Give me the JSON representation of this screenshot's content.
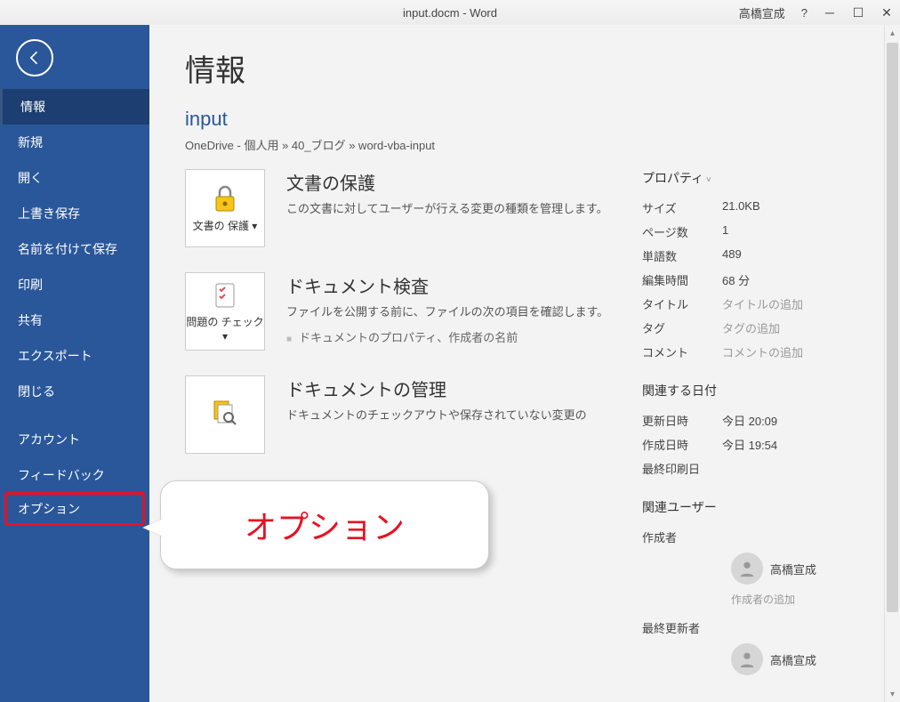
{
  "titlebar": {
    "title": "input.docm  -  Word",
    "user": "高橋宣成",
    "help": "?"
  },
  "sidebar": {
    "items": [
      {
        "label": "情報",
        "active": true
      },
      {
        "label": "新規"
      },
      {
        "label": "開く"
      },
      {
        "label": "上書き保存"
      },
      {
        "label": "名前を付けて保存"
      },
      {
        "label": "印刷"
      },
      {
        "label": "共有"
      },
      {
        "label": "エクスポート"
      },
      {
        "label": "閉じる"
      }
    ],
    "bottom": [
      {
        "label": "アカウント"
      },
      {
        "label": "フィードバック"
      },
      {
        "label": "オプション",
        "highlighted": true
      }
    ]
  },
  "main": {
    "heading": "情報",
    "docname": "input",
    "breadcrumb": "OneDrive - 個人用 » 40_ブログ » word-vba-input",
    "sections": [
      {
        "button": "文書の\n保護 ▾",
        "title": "文書の保護",
        "desc": "この文書に対してユーザーが行える変更の種類を管理します。"
      },
      {
        "button": "問題の\nチェック ▾",
        "title": "ドキュメント検査",
        "desc": "ファイルを公開する前に、ファイルの次の項目を確認します。",
        "sub": "ドキュメントのプロパティ、作成者の名前"
      },
      {
        "button": "",
        "title": "ドキュメントの管理",
        "desc": "ドキュメントのチェックアウトや保存されていない変更の"
      }
    ]
  },
  "props": {
    "heading": "プロパティ",
    "rows": [
      {
        "label": "サイズ",
        "value": "21.0KB"
      },
      {
        "label": "ページ数",
        "value": "1"
      },
      {
        "label": "単語数",
        "value": "489"
      },
      {
        "label": "編集時間",
        "value": "68 分"
      },
      {
        "label": "タイトル",
        "value": "タイトルの追加",
        "placeholder": true
      },
      {
        "label": "タグ",
        "value": "タグの追加",
        "placeholder": true
      },
      {
        "label": "コメント",
        "value": "コメントの追加",
        "placeholder": true
      }
    ],
    "dates_heading": "関連する日付",
    "dates": [
      {
        "label": "更新日時",
        "value": "今日 20:09"
      },
      {
        "label": "作成日時",
        "value": "今日 19:54"
      },
      {
        "label": "最終印刷日",
        "value": ""
      }
    ],
    "users_heading": "関連ユーザー",
    "author_label": "作成者",
    "author_name": "高橋宣成",
    "add_author": "作成者の追加",
    "last_modified_label": "最終更新者",
    "last_modified_name": "高橋宣成"
  },
  "callout": {
    "text": "オプション"
  }
}
